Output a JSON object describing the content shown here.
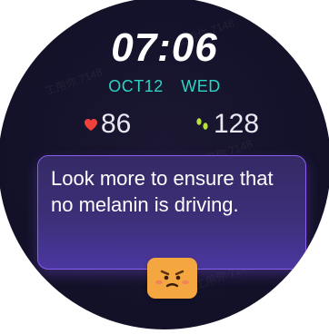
{
  "watch": {
    "time": "07:06",
    "date": "OCT12",
    "weekday": "WED",
    "heart_rate": "86",
    "steps": "128",
    "message": "Look more to ensure that no melanin is driving.",
    "icons": {
      "heart": "heart-icon",
      "steps": "footsteps-icon",
      "emoji": "worried-face-icon"
    },
    "colors": {
      "background": "#14122a",
      "date_text": "#2ed3c2",
      "heart": "#f0413a",
      "steps": "#b7e23b",
      "card_border": "#8a5ff0",
      "card_fill": "#3d2f78",
      "emoji_badge": "#f4a641"
    }
  }
}
